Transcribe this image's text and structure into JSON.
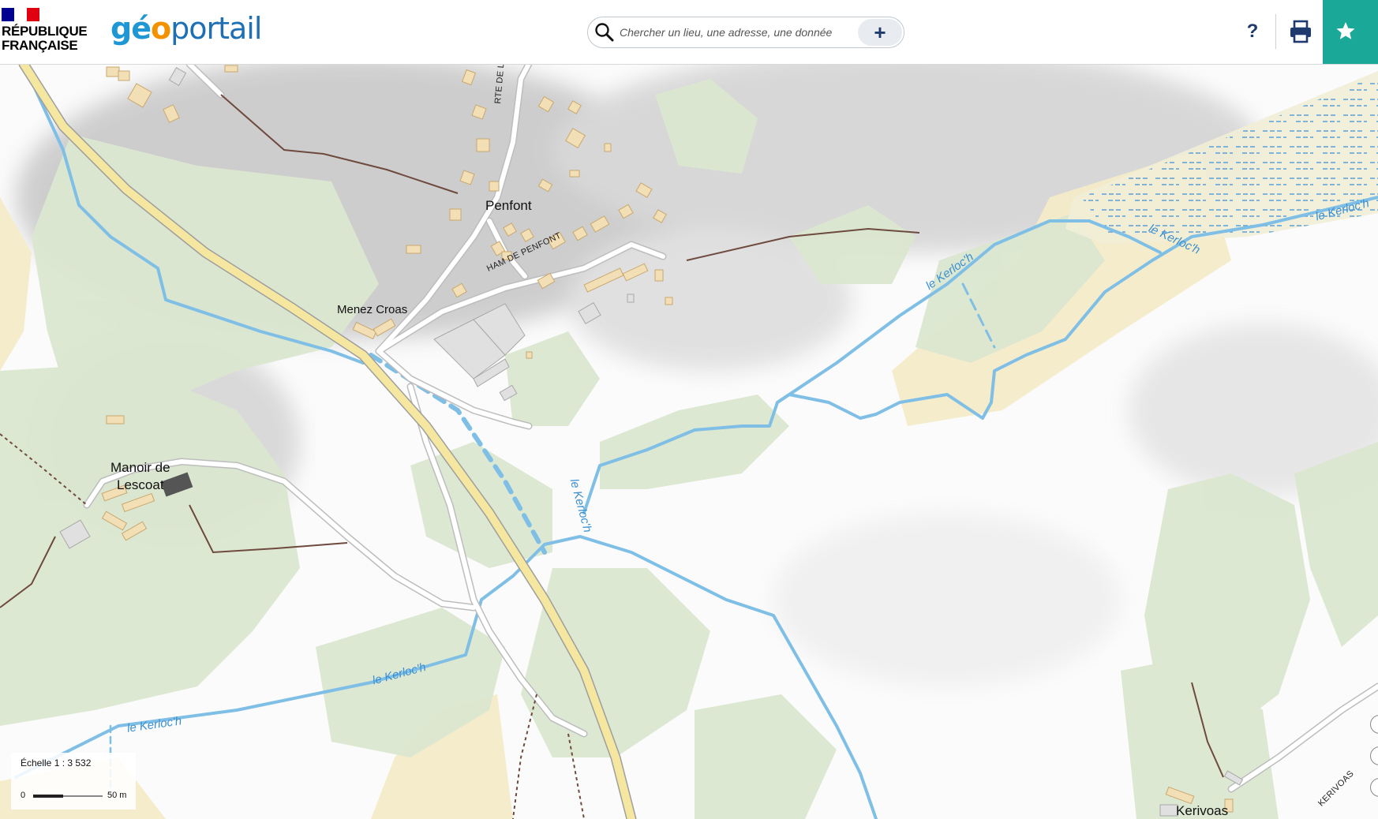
{
  "header": {
    "republique_line1": "RÉPUBLIQUE",
    "republique_line2": "FRANÇAISE",
    "logo_geo": "géo",
    "logo_o": "o",
    "logo_portail": "portail",
    "search_placeholder": "Chercher un lieu, une adresse, une donnée",
    "plus_label": "+",
    "help_label": "?",
    "print_icon": "printer-icon",
    "favorite_icon": "star-icon"
  },
  "colors": {
    "accent": "#1aa898",
    "navy": "#1e3a6e",
    "water": "#7fbfe6",
    "forest": "#d9e6cf",
    "field": "#f4ebc8",
    "road_main": "#f6e7a0",
    "building": "#f2dfb5"
  },
  "map": {
    "places": {
      "penfont": "Penfont",
      "menez_croas": "Menez Croas",
      "manoir_line1": "Manoir de",
      "manoir_line2": "Lescoat",
      "kerivoas": "Kerivoas"
    },
    "roads": {
      "rte_landaoue": "RTE DE LANDAOUE",
      "ham_penfont": "HAM DE PENFONT",
      "kerivoas_road": "KERIVOAS"
    },
    "rivers": {
      "r1": "le Kerloc'h",
      "r2": "le Kerloc'h",
      "r3": "le Kerloc'h",
      "r4": "le Kerloc'h",
      "r5": "le Kerloc'h",
      "r6": "le Kerloc'h"
    },
    "scale": {
      "label": "Échelle 1 :  3 532",
      "zero": "0",
      "distance": "50 m"
    }
  }
}
